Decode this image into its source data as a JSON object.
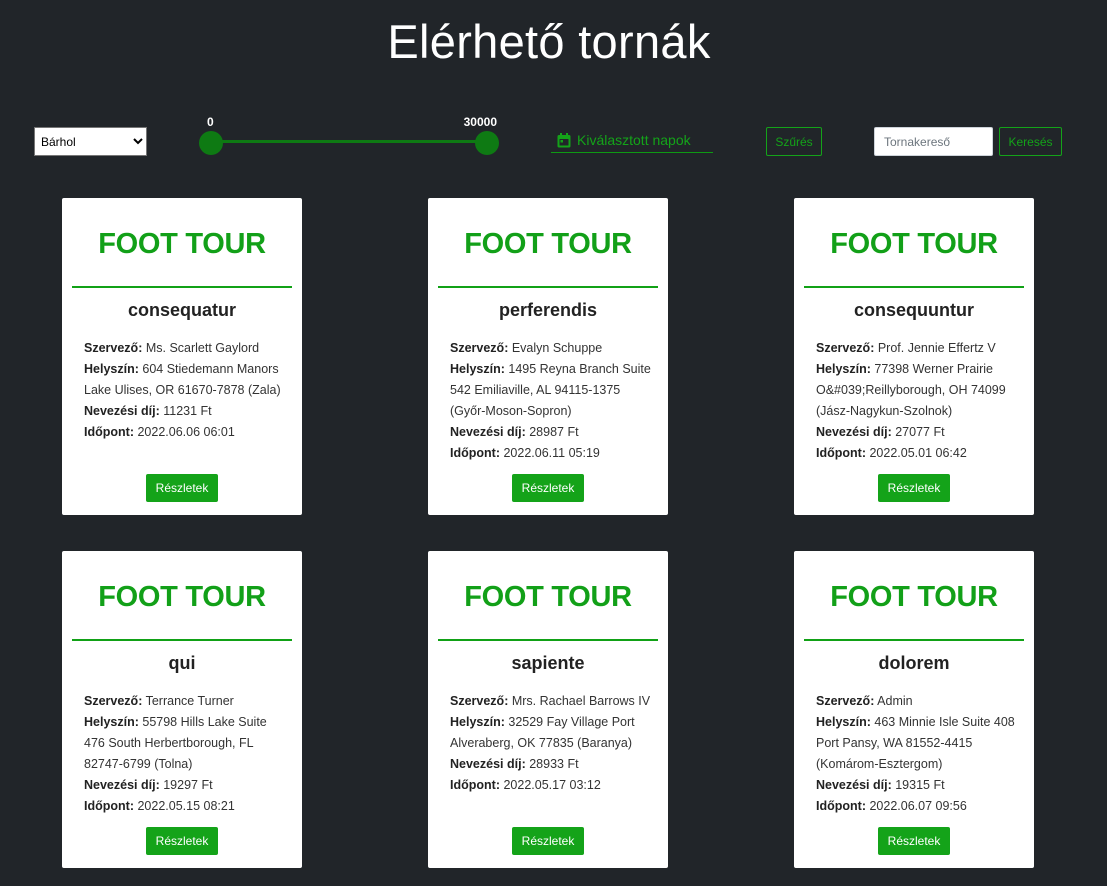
{
  "header": {
    "title": "Elérhető tornák"
  },
  "filters": {
    "location_selected": "Bárhol",
    "price_min_label": "0",
    "price_max_label": "30000",
    "date_placeholder": "Kiválasztott napok",
    "filter_button": "Szűrés",
    "search_placeholder": "Tornakereső",
    "search_button": "Keresés"
  },
  "labels": {
    "organizer": "Szervező:",
    "location": "Helyszín:",
    "fee": "Nevezési díj:",
    "time": "Időpont:",
    "details": "Részletek"
  },
  "cards": [
    {
      "logo": "FOOT TOUR",
      "title": "consequatur",
      "organizer": "Ms. Scarlett Gaylord",
      "location": "604 Stiedemann Manors Lake Ulises, OR 61670-7878 (Zala)",
      "fee": "11231 Ft",
      "time": "2022.06.06 06:01"
    },
    {
      "logo": "FOOT TOUR",
      "title": "perferendis",
      "organizer": "Evalyn Schuppe",
      "location": "1495 Reyna Branch Suite 542 Emiliaville, AL 94115-1375 (Győr-Moson-Sopron)",
      "fee": "28987 Ft",
      "time": "2022.06.11 05:19"
    },
    {
      "logo": "FOOT TOUR",
      "title": "consequuntur",
      "organizer": "Prof. Jennie Effertz V",
      "location": "77398 Werner Prairie O&#039;Reillyborough, OH 74099 (Jász-Nagykun-Szolnok)",
      "fee": "27077 Ft",
      "time": "2022.05.01 06:42"
    },
    {
      "logo": "FOOT TOUR",
      "title": "qui",
      "organizer": "Terrance Turner",
      "location": "55798 Hills Lake Suite 476 South Herbertborough, FL 82747-6799 (Tolna)",
      "fee": "19297 Ft",
      "time": "2022.05.15 08:21"
    },
    {
      "logo": "FOOT TOUR",
      "title": "sapiente",
      "organizer": "Mrs. Rachael Barrows IV",
      "location": "32529 Fay Village Port Alveraberg, OK 77835 (Baranya)",
      "fee": "28933 Ft",
      "time": "2022.05.17 03:12"
    },
    {
      "logo": "FOOT TOUR",
      "title": "dolorem",
      "organizer": "Admin",
      "location": "463 Minnie Isle Suite 408 Port Pansy, WA 81552-4415 (Komárom-Esztergom)",
      "fee": "19315 Ft",
      "time": "2022.06.07 09:56"
    }
  ],
  "icons": {
    "date": "calendar-icon",
    "select": "chevron-down-icon"
  },
  "colors": {
    "background": "#212529",
    "accent": "#14a319",
    "card": "#ffffff"
  }
}
